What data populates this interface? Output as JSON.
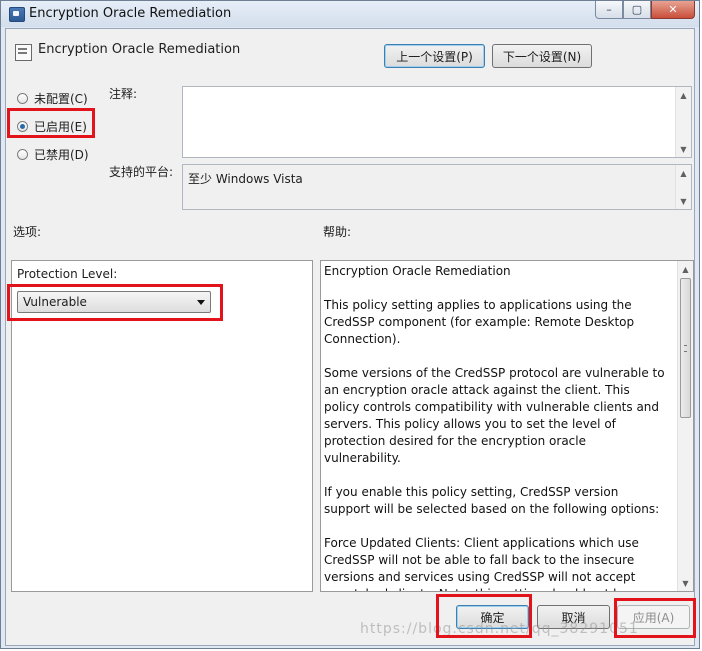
{
  "window": {
    "title": "Encryption Oracle Remediation",
    "minimize_glyph": "–",
    "maximize_glyph": "▢",
    "close_glyph": "✕"
  },
  "header": {
    "policy_title": "Encryption Oracle Remediation",
    "prev_button": "上一个设置(P)",
    "next_button": "下一个设置(N)"
  },
  "state": {
    "options": [
      {
        "label": "未配置(C)",
        "checked": false
      },
      {
        "label": "已启用(E)",
        "checked": true
      },
      {
        "label": "已禁用(D)",
        "checked": false
      }
    ]
  },
  "comment": {
    "label": "注释:",
    "value": ""
  },
  "platform": {
    "label": "支持的平台:",
    "value": "至少 Windows Vista"
  },
  "options_section": {
    "label": "选项:",
    "protection_label": "Protection Level:",
    "protection_value": "Vulnerable"
  },
  "help_section": {
    "label": "帮助:",
    "paragraphs": [
      "Encryption Oracle Remediation",
      "This policy setting applies to applications using the CredSSP component (for example: Remote Desktop Connection).",
      "Some versions of the CredSSP protocol are vulnerable to an encryption oracle attack against the client.  This policy controls compatibility with vulnerable clients and servers.  This policy allows you to set the level of protection desired for the encryption oracle vulnerability.",
      "If you enable this policy setting, CredSSP version support will be selected based on the following options:",
      "Force Updated Clients: Client applications which use CredSSP will not be able to fall back to the insecure versions and services using CredSSP will not accept unpatched clients. Note: this setting should not be"
    ]
  },
  "footer": {
    "ok_button": "确定",
    "cancel_button": "取消",
    "apply_button": "应用(A)"
  },
  "watermark": "https://blog.csdn.net/qq_38291051",
  "colors": {
    "highlight": "#e3131b",
    "radio_dot": "#2b6aa8"
  }
}
